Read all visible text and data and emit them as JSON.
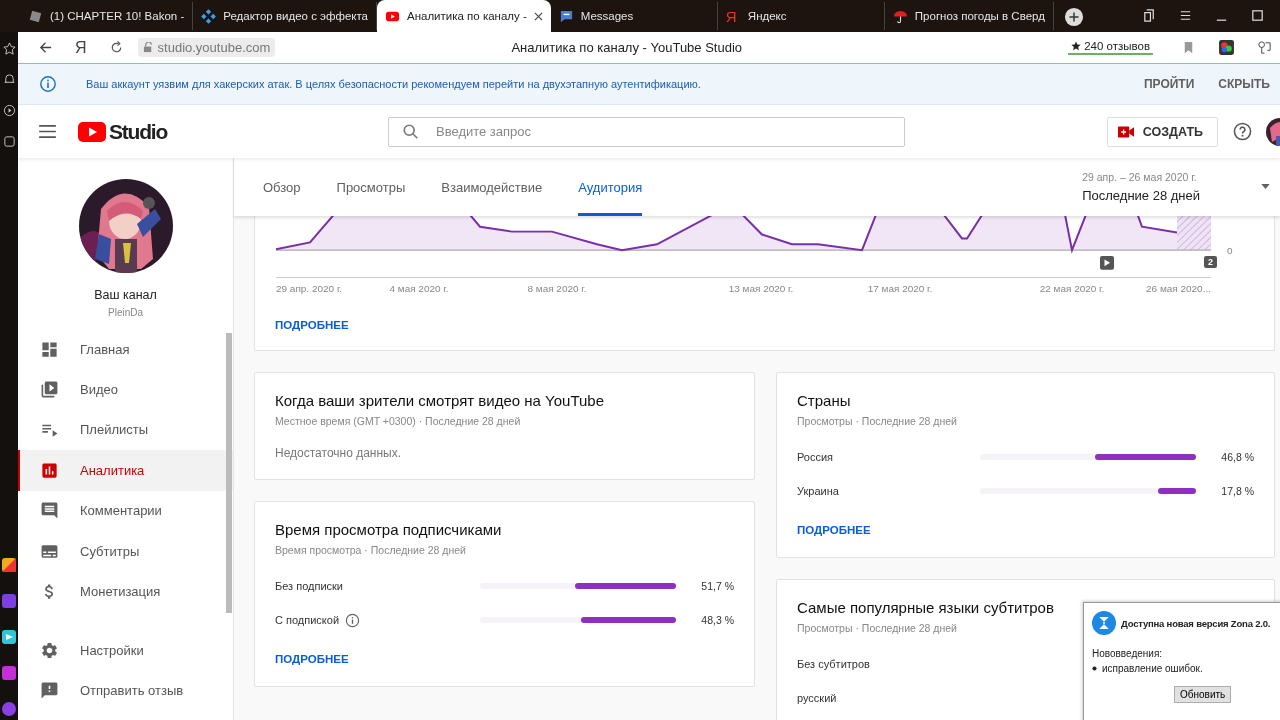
{
  "browser_tabs": [
    {
      "title": "(1) CHAPTER 10! Bakon -",
      "kind": "game",
      "selected": false
    },
    {
      "title": "Редактор видео с эффекта",
      "kind": "diamond",
      "selected": false
    },
    {
      "title": "Аналитика по каналу -",
      "kind": "video",
      "selected": true
    },
    {
      "title": "Messages",
      "kind": "chat",
      "selected": false
    },
    {
      "title": "Яндекс",
      "kind": "letter",
      "icon_char": "Я",
      "selected": false
    },
    {
      "title": "Прогноз погоды в Сверд",
      "kind": "umbrella",
      "selected": false
    }
  ],
  "address_bar": {
    "home_char": "Я",
    "url": "studio.youtube.com",
    "page_title": "Аналитика по каналу - YouTube Studio",
    "reviews": "240 отзывов"
  },
  "banner": {
    "text": "Ваш аккаунт уязвим для хакерских атак. В целях безопасности рекомендуем перейти на двухэтапную аутентификацию.",
    "actions": [
      "ПРОЙТИ",
      "СКРЫТЬ"
    ]
  },
  "header": {
    "logo": "Studio",
    "search_placeholder": "Введите запрос",
    "create": "СОЗДАТЬ"
  },
  "channel": {
    "name": "Ваш канал",
    "handle": "PleinDa"
  },
  "nav": [
    {
      "label": "Главная",
      "kind": "dashboard",
      "selected": false
    },
    {
      "label": "Видео",
      "kind": "video",
      "selected": false
    },
    {
      "label": "Плейлисты",
      "kind": "playlist",
      "selected": false
    },
    {
      "label": "Аналитика",
      "kind": "analytics",
      "selected": true
    },
    {
      "label": "Комментарии",
      "kind": "comment",
      "selected": false
    },
    {
      "label": "Субтитры",
      "kind": "subtitles",
      "selected": false
    },
    {
      "label": "Монетизация",
      "kind": "money",
      "selected": false
    }
  ],
  "nav_footer": [
    {
      "label": "Настройки",
      "kind": "gear"
    },
    {
      "label": "Отправить отзыв",
      "kind": "feedback"
    }
  ],
  "analytics_tabs": [
    {
      "label": "Обзор",
      "selected": false
    },
    {
      "label": "Просмотры",
      "selected": false
    },
    {
      "label": "Взаимодействие",
      "selected": false
    },
    {
      "label": "Аудитория",
      "selected": true
    }
  ],
  "date_range": {
    "range": "29 апр. – 26 мая 2020 г.",
    "preset": "Последние 28 дней"
  },
  "activity_chart": {
    "date_labels": [
      "29 апр. 2020 г.",
      "4 мая 2020 г.",
      "8 мая 2020 г.",
      "13 мая 2020 г.",
      "17 мая 2020 г.",
      "22 мая 2020 г.",
      "26 мая 2020..."
    ],
    "zero_label": "0",
    "badge": "2",
    "link": "ПОДРОБНЕЕ"
  },
  "when_watch": {
    "title": "Когда ваши зрители смотрят видео на YouTube",
    "subtitle": "Местное время (GMT +0300) · Последние 28 дней",
    "message": "Недостаточно данных."
  },
  "subscriber_watch_time": {
    "title": "Время просмотра подписчиками",
    "subtitle": "Время просмотра · Последние 28 дней",
    "rows": [
      {
        "label": "Без подписки",
        "level": 0.517,
        "reading": "51,7 %",
        "info": false
      },
      {
        "label": "С подпиской",
        "level": 0.483,
        "reading": "48,3 %",
        "info": true
      }
    ],
    "link": "ПОДРОБНЕЕ"
  },
  "countries": {
    "title": "Страны",
    "subtitle": "Просмотры · Последние 28 дней",
    "rows": [
      {
        "label": "Россия",
        "level": 0.468,
        "reading": "46,8 %"
      },
      {
        "label": "Украина",
        "level": 0.178,
        "reading": "17,8 %"
      }
    ],
    "link": "ПОДРОБНЕЕ"
  },
  "subtitle_languages": {
    "title": "Самые популярные языки субтитров",
    "subtitle": "Просмотры · Последние 28 дней",
    "rows": [
      {
        "label": "Без субтитров"
      },
      {
        "label": "русский"
      }
    ]
  },
  "update_popup": {
    "title": "Доступна новая версия Zona 2.0.",
    "heading": "Нововведения:",
    "items": [
      "исправление ошибок."
    ],
    "button": "Обновить"
  }
}
